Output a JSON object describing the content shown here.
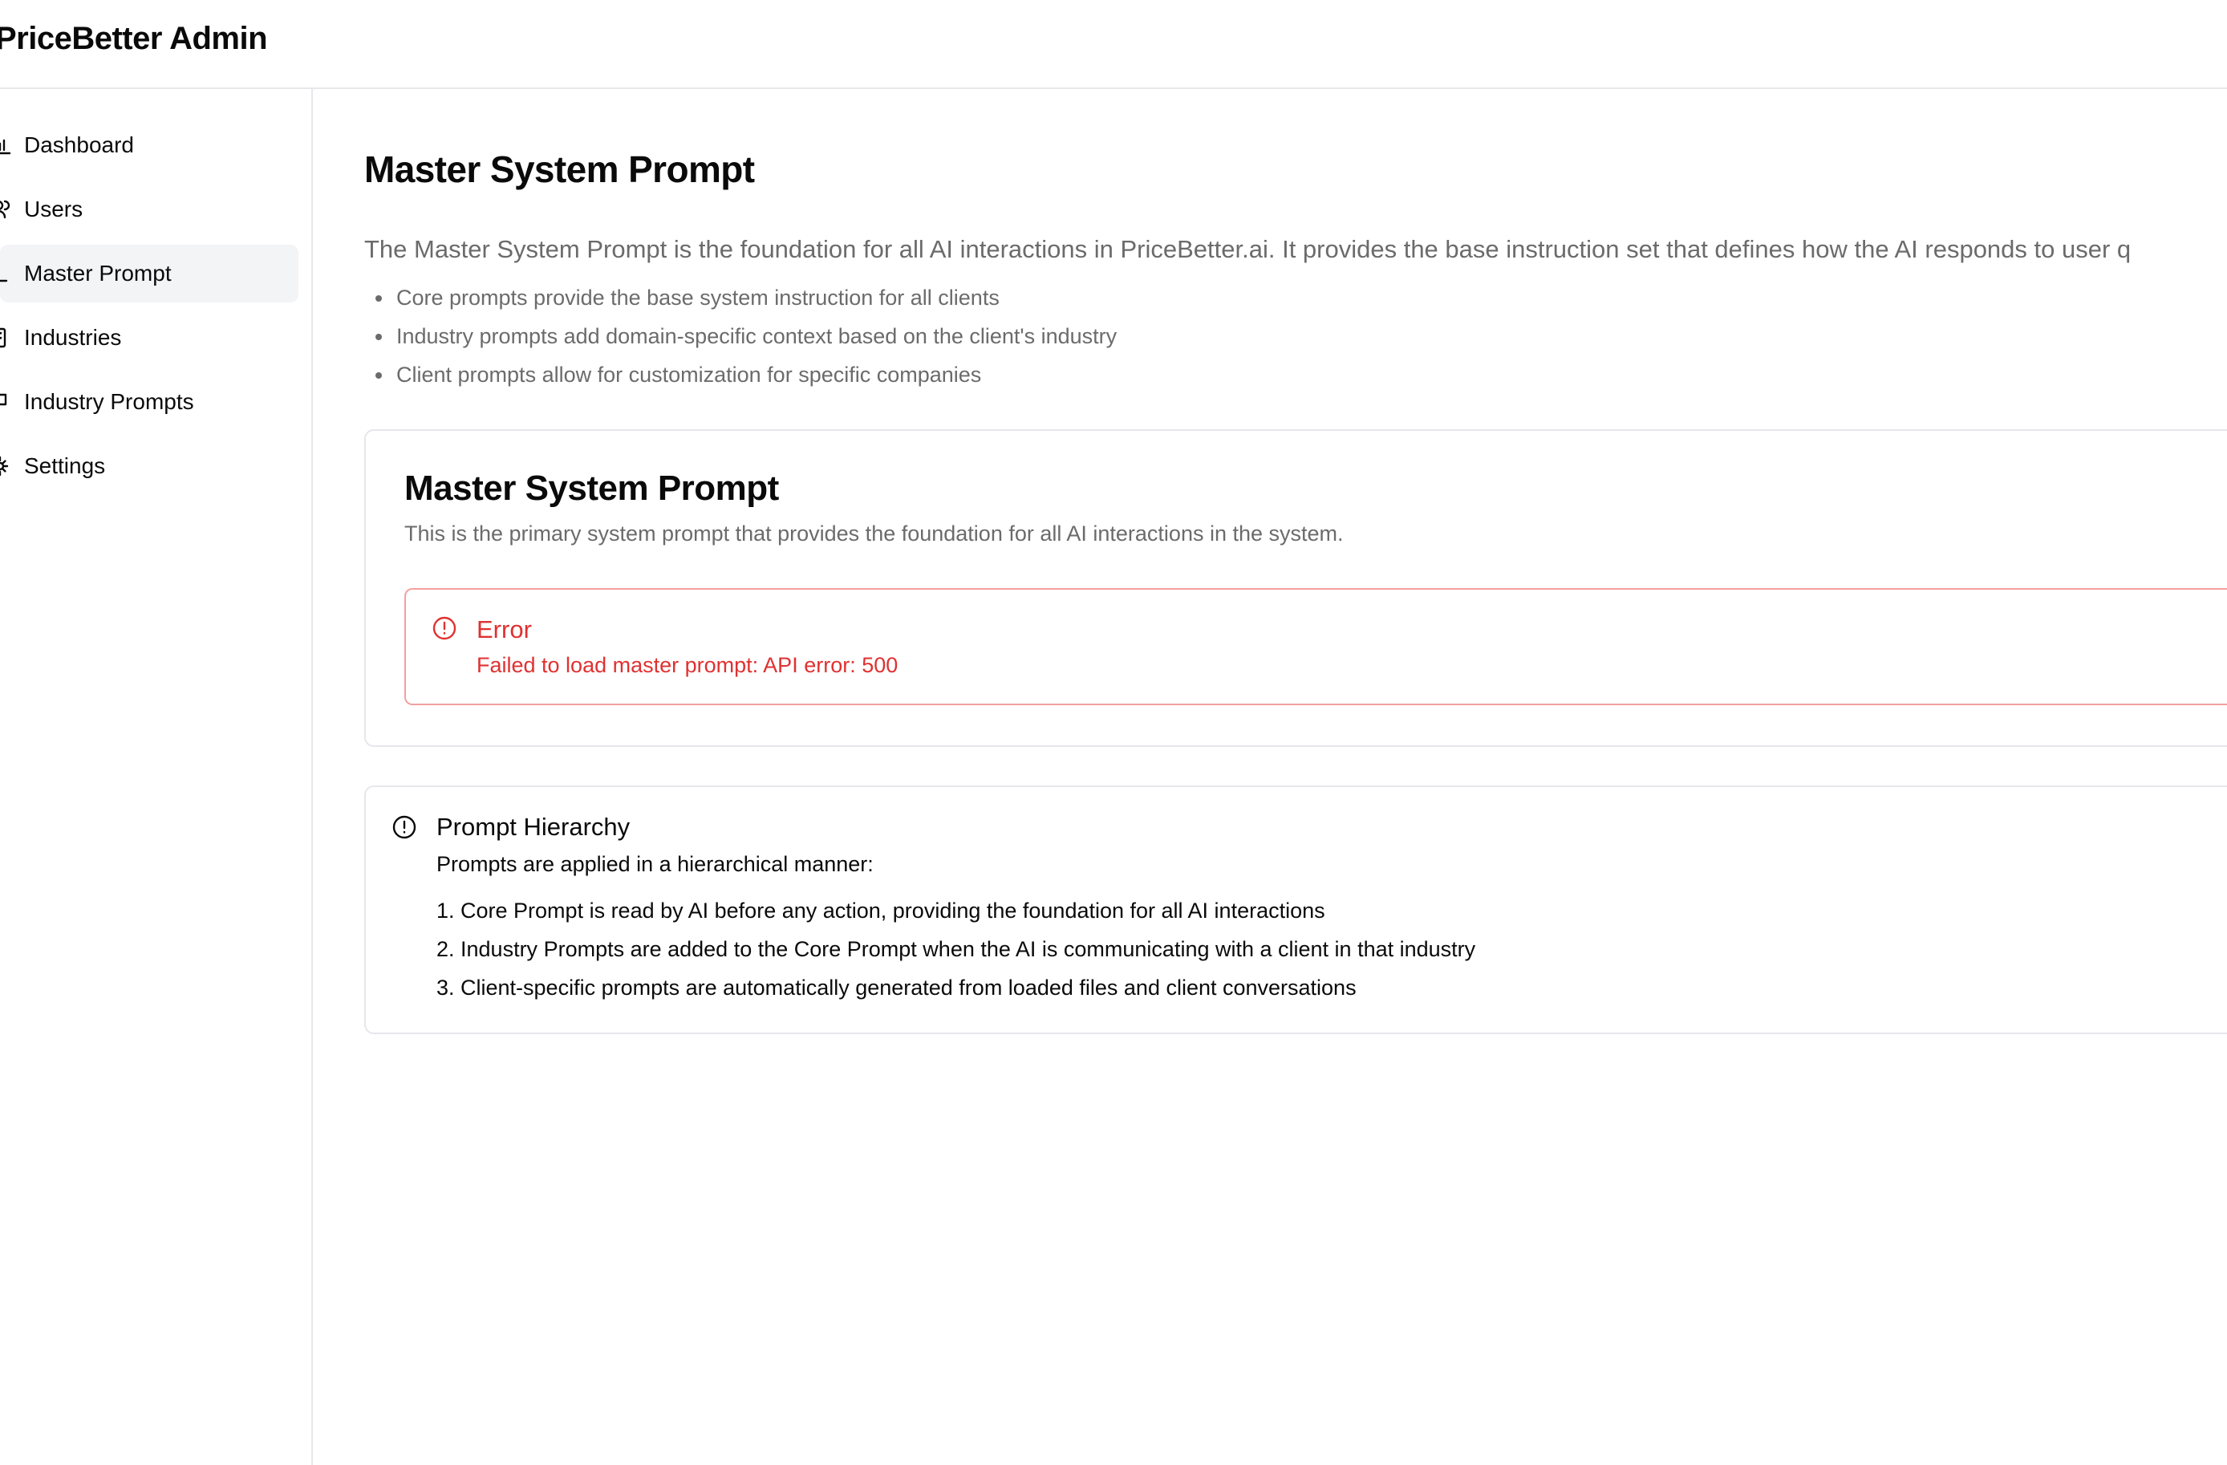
{
  "header": {
    "title": "PriceBetter Admin"
  },
  "sidebar": {
    "items": [
      {
        "label": "Dashboard",
        "icon": "bar-chart-icon",
        "active": false
      },
      {
        "label": "Users",
        "icon": "users-icon",
        "active": false
      },
      {
        "label": "Master Prompt",
        "icon": "terminal-icon",
        "active": true
      },
      {
        "label": "Industries",
        "icon": "building-icon",
        "active": false
      },
      {
        "label": "Industry Prompts",
        "icon": "message-square-icon",
        "active": false
      },
      {
        "label": "Settings",
        "icon": "gear-icon",
        "active": false
      }
    ]
  },
  "main": {
    "title": "Master System Prompt",
    "intro": "The Master System Prompt is the foundation for all AI interactions in PriceBetter.ai. It provides the base instruction set that defines how the AI responds to user q",
    "bullets": [
      "Core prompts provide the base system instruction for all clients",
      "Industry prompts add domain-specific context based on the client's industry",
      "Client prompts allow for customization for specific companies"
    ],
    "prompt_card": {
      "title": "Master System Prompt",
      "subtitle": "This is the primary system prompt that provides the foundation for all AI interactions in the system.",
      "error": {
        "title": "Error",
        "message": "Failed to load master prompt: API error: 500",
        "color": "#e03131"
      }
    },
    "hierarchy_card": {
      "title": "Prompt Hierarchy",
      "intro": "Prompts are applied in a hierarchical manner:",
      "items": [
        "1. Core Prompt is read by AI before any action, providing the foundation for all AI interactions",
        "2. Industry Prompts are added to the Core Prompt when the AI is communicating with a client in that industry",
        "3. Client-specific prompts are automatically generated from loaded files and client conversations"
      ]
    }
  }
}
